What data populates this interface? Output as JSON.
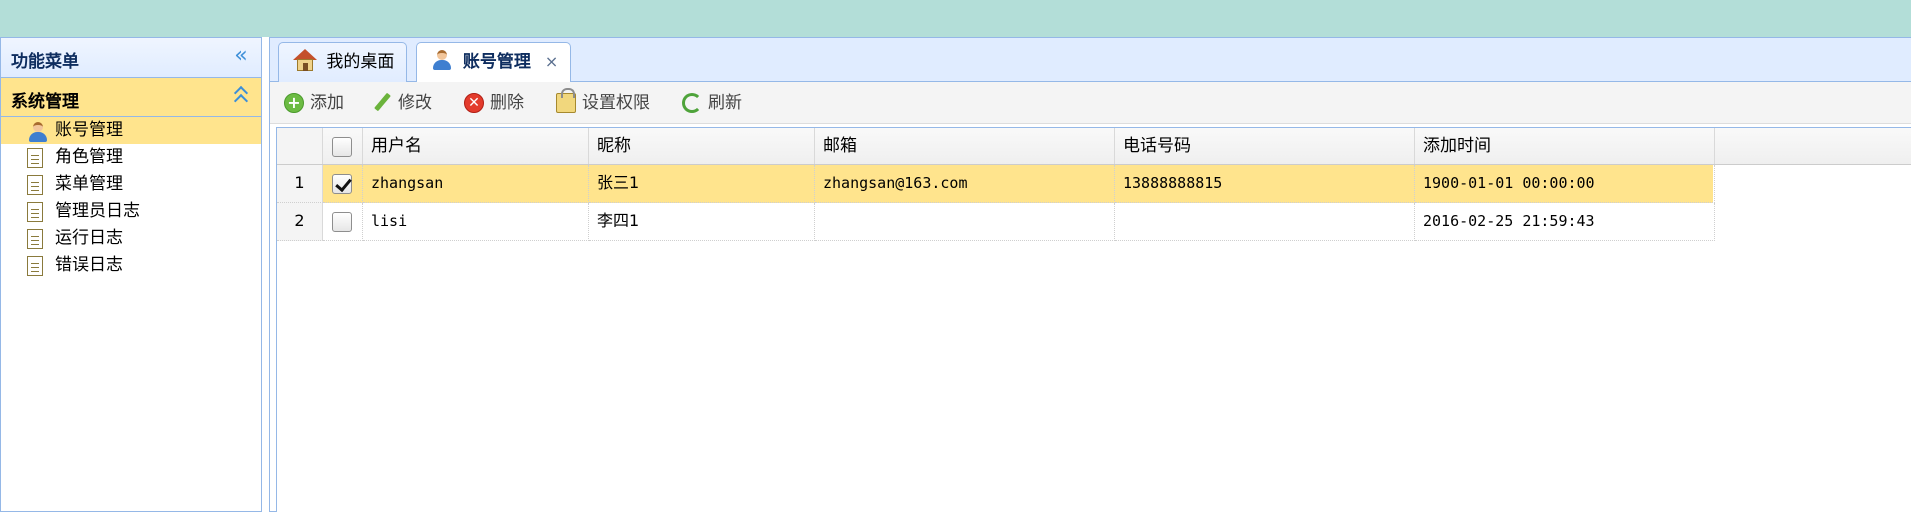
{
  "west": {
    "title": "功能菜单",
    "section": {
      "title": "系统管理"
    },
    "menu_items": [
      {
        "label": "账号管理",
        "icon": "user-icon",
        "selected": true
      },
      {
        "label": "角色管理",
        "icon": "document-icon"
      },
      {
        "label": "菜单管理",
        "icon": "document-icon"
      },
      {
        "label": "管理员日志",
        "icon": "document-icon"
      },
      {
        "label": "运行日志",
        "icon": "document-icon"
      },
      {
        "label": "错误日志",
        "icon": "document-icon"
      }
    ]
  },
  "tabs": [
    {
      "label": "我的桌面",
      "icon": "home-icon"
    },
    {
      "label": "账号管理",
      "icon": "user-icon",
      "selected": true,
      "close": "×"
    }
  ],
  "toolbar": {
    "add": "添加",
    "edit": "修改",
    "delete": "删除",
    "permissions": "设置权限",
    "refresh": "刷新"
  },
  "grid": {
    "columns": [
      "用户名",
      "昵称",
      "邮箱",
      "电话号码",
      "添加时间"
    ],
    "rows": [
      {
        "num": "1",
        "checked": true,
        "selected": true,
        "username": "zhangsan",
        "nickname": "张三1",
        "email": "zhangsan@163.com",
        "phone": "13888888815",
        "added": "1900-01-01 00:00:00"
      },
      {
        "num": "2",
        "checked": false,
        "username": "lisi",
        "nickname": "李四1",
        "email": "",
        "phone": "",
        "added": "2016-02-25 21:59:43"
      }
    ]
  },
  "colors": {
    "banner": "#b3ded8",
    "panel_border": "#95b8e7",
    "selected_row": "#ffe48d"
  }
}
